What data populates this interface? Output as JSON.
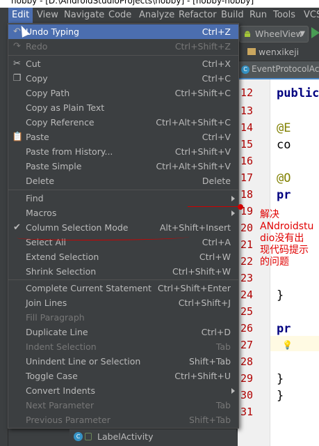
{
  "window": {
    "title": "hobby - [D:\\AndroidStudioProjects\\hobby] - [hobby-hobby]"
  },
  "menubar": [
    "Edit",
    "View",
    "Navigate",
    "Code",
    "Analyze",
    "Refactor",
    "Build",
    "Run",
    "Tools",
    "VCS"
  ],
  "toolbar": {
    "run_config": "WheelView"
  },
  "breadcrumb": {
    "folder": "wenxikeji"
  },
  "editor_tab": {
    "file": "EventProtocolActi"
  },
  "editor": {
    "line_numbers": [
      "12",
      "13",
      "14",
      "15",
      "16",
      "17",
      "18",
      "19",
      "20",
      "21",
      "22",
      "23",
      "24",
      "25",
      "26",
      "27",
      "28",
      "29",
      "30",
      "31"
    ],
    "code": {
      "line12": "public",
      "line14": "@E",
      "line15": "co",
      "line17": "@O",
      "line18": "pr",
      "line24": "}",
      "line26": "pr",
      "line29": "}",
      "line30": "}"
    }
  },
  "edit_menu": {
    "undo": {
      "label": "Undo Typing",
      "shortcut": "Ctrl+Z"
    },
    "redo": {
      "label": "Redo",
      "shortcut": "Ctrl+Shift+Z"
    },
    "cut": {
      "label": "Cut",
      "shortcut": "Ctrl+X"
    },
    "copy": {
      "label": "Copy",
      "shortcut": "Ctrl+C"
    },
    "copy_path": {
      "label": "Copy Path",
      "shortcut": "Ctrl+Shift+C"
    },
    "copy_plain": {
      "label": "Copy as Plain Text",
      "shortcut": ""
    },
    "copy_reference": {
      "label": "Copy Reference",
      "shortcut": "Ctrl+Alt+Shift+C"
    },
    "paste": {
      "label": "Paste",
      "shortcut": "Ctrl+V"
    },
    "paste_history": {
      "label": "Paste from History...",
      "shortcut": "Ctrl+Shift+V"
    },
    "paste_simple": {
      "label": "Paste Simple",
      "shortcut": "Ctrl+Alt+Shift+V"
    },
    "delete": {
      "label": "Delete",
      "shortcut": "Delete"
    },
    "find": {
      "label": "Find"
    },
    "macros": {
      "label": "Macros"
    },
    "column_selection": {
      "label": "Column Selection Mode",
      "shortcut": "Alt+Shift+Insert",
      "checked": true
    },
    "select_all": {
      "label": "Select All",
      "shortcut": "Ctrl+A"
    },
    "extend_selection": {
      "label": "Extend Selection",
      "shortcut": "Ctrl+W"
    },
    "shrink_selection": {
      "label": "Shrink Selection",
      "shortcut": "Ctrl+Shift+W"
    },
    "complete_statement": {
      "label": "Complete Current Statement",
      "shortcut": "Ctrl+Shift+Enter"
    },
    "join_lines": {
      "label": "Join Lines",
      "shortcut": "Ctrl+Shift+J"
    },
    "fill_paragraph": {
      "label": "Fill Paragraph",
      "shortcut": ""
    },
    "duplicate_line": {
      "label": "Duplicate Line",
      "shortcut": "Ctrl+D"
    },
    "indent_selection": {
      "label": "Indent Selection",
      "shortcut": "Tab"
    },
    "unindent": {
      "label": "Unindent Line or Selection",
      "shortcut": "Shift+Tab"
    },
    "toggle_case": {
      "label": "Toggle Case",
      "shortcut": "Ctrl+Shift+U"
    },
    "convert_indents": {
      "label": "Convert Indents"
    },
    "next_param": {
      "label": "Next Parameter",
      "shortcut": "Tab"
    },
    "prev_param": {
      "label": "Previous Parameter",
      "shortcut": "Shift+Tab"
    }
  },
  "annotation": {
    "line1": "解决",
    "line2": "ANdroidstu",
    "line3": "dio没有出",
    "line4": "现代码提示",
    "line5": "的问题"
  },
  "bottom": {
    "label": "LabelActivity"
  },
  "colors": {
    "selection": "#4b6eaf",
    "menu_bg": "#3c3f41",
    "annotation": "#e00000"
  }
}
